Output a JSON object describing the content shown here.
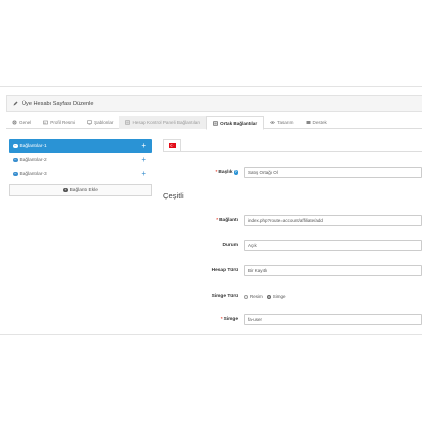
{
  "panel": {
    "title": "Üye Hesabı Sayfası Düzenle"
  },
  "tabs": [
    {
      "label": "Genel",
      "icon": "cog-icon",
      "state": "normal"
    },
    {
      "label": "Profil Resmi",
      "icon": "image-icon",
      "state": "normal"
    },
    {
      "label": "Şablonlar",
      "icon": "monitor-icon",
      "state": "normal"
    },
    {
      "label": "Hesap Kontrol Paneli Bağlantıları",
      "icon": "list-icon",
      "state": "disabled"
    },
    {
      "label": "Ortak Bağlantılar",
      "icon": "list-icon",
      "state": "active"
    },
    {
      "label": "Tasarım",
      "icon": "eye-icon",
      "state": "normal"
    },
    {
      "label": "Destek",
      "icon": "card-icon",
      "state": "normal"
    }
  ],
  "sidebar": {
    "items": [
      {
        "label": "Bağlantılar-1",
        "active": true
      },
      {
        "label": "Bağlantılar-2",
        "active": false
      },
      {
        "label": "Bağlantılar-3",
        "active": false
      }
    ],
    "add_label": "Bağlantı Ekle"
  },
  "language": {
    "flag": "turkey-flag-icon"
  },
  "form": {
    "title_label": "Başlık",
    "title_value": "Satış Ortağı Ol",
    "section_title": "Çeşitli",
    "link_label": "Bağlantı",
    "link_value": "index.php?route=account/affiliate/add",
    "status_label": "Durum",
    "status_value": "Açık",
    "account_type_label": "Hesap Türü",
    "account_type_value": "Bir Kayıtlı",
    "icon_type_label": "Simge Türü",
    "icon_type_options": [
      "Resim",
      "Simge"
    ],
    "icon_type_selected": "Simge",
    "icon_label": "Simge",
    "icon_value": "fa-user"
  },
  "colors": {
    "accent": "#2a93d5",
    "required": "#e74c3c"
  }
}
